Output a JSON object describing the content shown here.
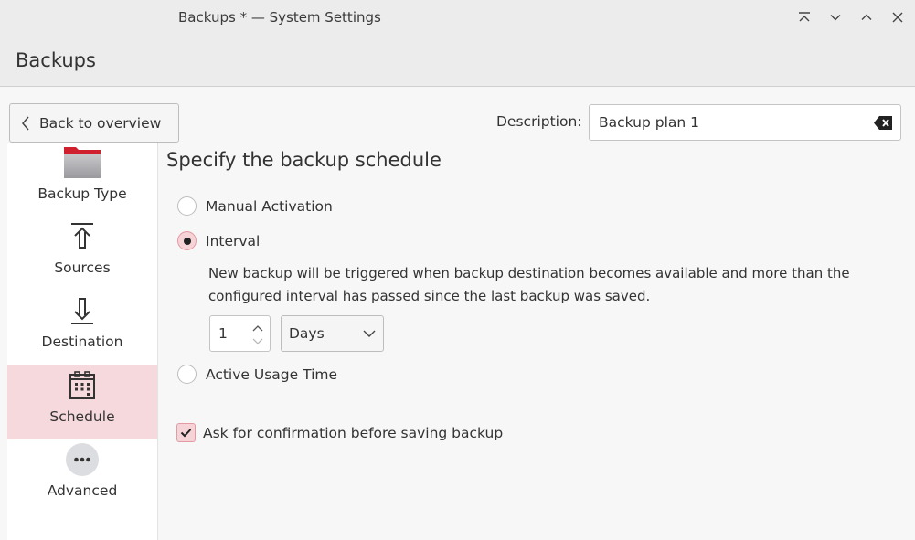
{
  "window": {
    "title": "Backups * — System Settings",
    "controls": [
      {
        "name": "keep-above",
        "icon": "keep-above-icon"
      },
      {
        "name": "minimize",
        "icon": "chevron-down-icon"
      },
      {
        "name": "maximize",
        "icon": "chevron-up-icon"
      },
      {
        "name": "close",
        "icon": "close-icon"
      }
    ]
  },
  "header": {
    "title": "Backups"
  },
  "back_button": {
    "label": "Back to overview",
    "icon": "chevron-left-icon"
  },
  "description": {
    "label": "Description:",
    "value": "Backup plan 1",
    "clear_icon": "edit-clear-icon"
  },
  "sidebar": {
    "items": [
      {
        "label": "Backup Type",
        "icon": "folder-icon",
        "active": false
      },
      {
        "label": "Sources",
        "icon": "upload-icon",
        "active": false
      },
      {
        "label": "Destination",
        "icon": "download-icon",
        "active": false
      },
      {
        "label": "Schedule",
        "icon": "calendar-icon",
        "active": true
      },
      {
        "label": "Advanced",
        "icon": "more-icon",
        "active": false
      }
    ]
  },
  "schedule": {
    "title": "Specify the backup schedule",
    "options": [
      {
        "label": "Manual Activation",
        "checked": false
      },
      {
        "label": "Interval",
        "checked": true
      },
      {
        "label": "Active Usage Time",
        "checked": false
      }
    ],
    "interval_help": "New backup will be triggered when backup destination becomes available and more than the configured interval has passed since the last backup was saved.",
    "interval_value": "1",
    "interval_unit": "Days",
    "confirm_label": "Ask for confirmation before saving backup",
    "confirm_checked": true
  },
  "colors": {
    "accent_highlight": "#f5d9dc",
    "folder_red": "#d0202e"
  }
}
